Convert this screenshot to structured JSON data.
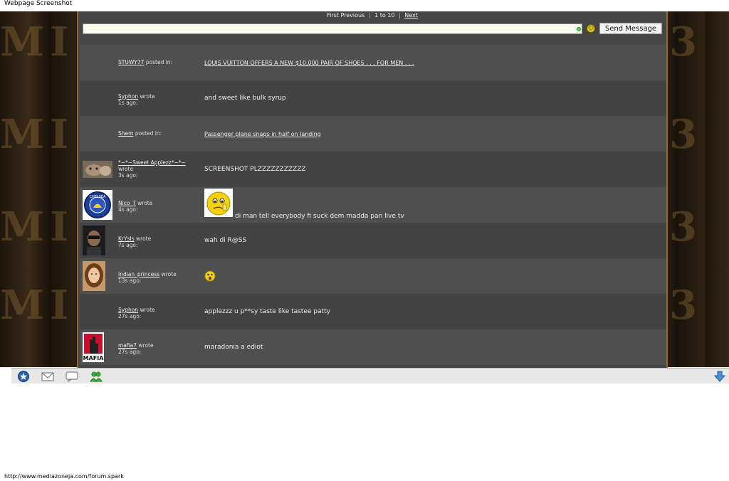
{
  "screenshot_label": "Webpage Screenshot",
  "url": "http://www.mediazoneja.com/forum.spark",
  "pager": {
    "first": "First",
    "previous": "Previous",
    "range": "1 to 10",
    "next": "Next"
  },
  "chat_input": {
    "value": "",
    "placeholder": ""
  },
  "send_button": "Send Message",
  "feed": [
    {
      "user": "STUWY77",
      "action": "posted in:",
      "time": "",
      "message": "LOUIS VUITTON OFFERS A NEW $10,000 PAIR OF SHOES . . . FOR MEN . . .",
      "message_is_link": true,
      "avatar": "none"
    },
    {
      "user": "Syphon",
      "action": "wrote",
      "time": "1s ago:",
      "message": "and sweet like bulk syrup",
      "message_is_link": false,
      "avatar": "none"
    },
    {
      "user": "Shem",
      "action": "posted in:",
      "time": "",
      "message": "Passenger plane snaps in half on landing",
      "message_is_link": true,
      "avatar": "none"
    },
    {
      "user": "*~*~Sweet Applezz*~*~",
      "action": "wrote",
      "time": "3s ago:",
      "message": "SCREENSHOT PLZZZZZZZZZZZ",
      "message_is_link": false,
      "avatar": "cat"
    },
    {
      "user": "Nico_T",
      "action": "wrote",
      "time": "4s ago:",
      "message": "di man tell everybody fi suck dem madda pan live tv",
      "message_is_link": false,
      "avatar": "chelsea",
      "emoticon": "big-smiley"
    },
    {
      "user": "KrYsIs",
      "action": "wrote",
      "time": "7s ago:",
      "message": "wah di R@SS",
      "message_is_link": false,
      "avatar": "man"
    },
    {
      "user": "Indian_princess",
      "action": "wrote",
      "time": "13s ago:",
      "message": "",
      "message_is_link": false,
      "avatar": "girl",
      "emoticon": "small-shocked"
    },
    {
      "user": "Syphon",
      "action": "wrote",
      "time": "27s ago:",
      "message": "applezzz u p**sy taste like tastee patty",
      "message_is_link": false,
      "avatar": "none"
    },
    {
      "user": "mafia7",
      "action": "wrote",
      "time": "27s ago:",
      "message": "maradonia a ediot",
      "message_is_link": false,
      "avatar": "mafia"
    }
  ],
  "avatar_text": {
    "chelsea": "CHELSEA",
    "mafia": "MAFIA"
  },
  "taskbar": [
    "star-icon",
    "mail-icon",
    "chat-icon",
    "friends-icon",
    "download-arrow-icon"
  ]
}
